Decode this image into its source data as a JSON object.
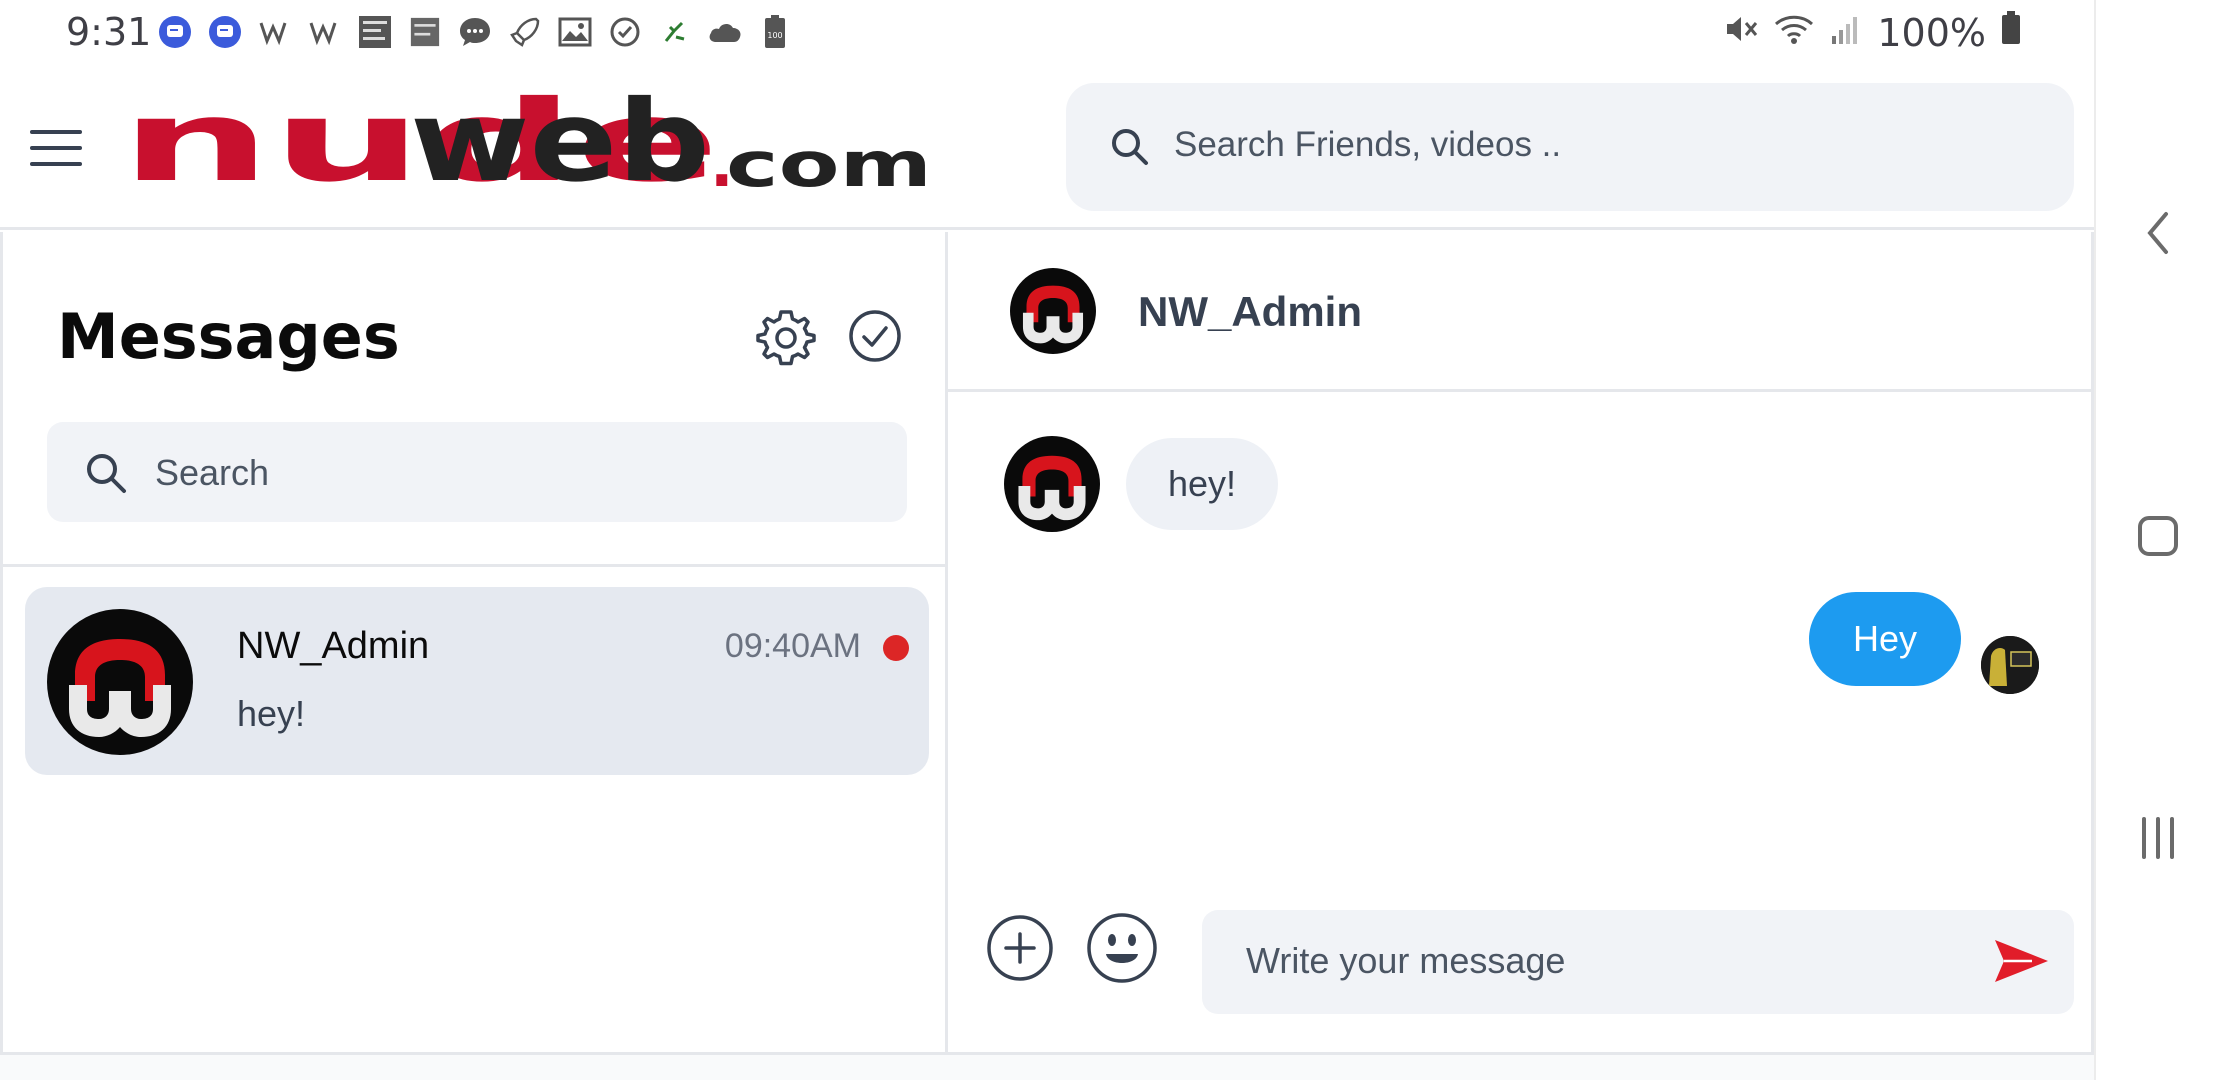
{
  "status_bar": {
    "time": "9:31",
    "battery_percent": "100%",
    "notification_icons": [
      "messages-icon",
      "messages-icon",
      "walmart-icon",
      "walmart-icon",
      "weather-channel-icon",
      "weather-channel-icon",
      "chat-icon",
      "rocket-icon",
      "image-icon",
      "check-icon",
      "dots-icon",
      "cloud-icon",
      "battery-100-icon"
    ],
    "right_icons": [
      "mute-icon",
      "wifi-icon",
      "signal-icon",
      "battery-icon"
    ]
  },
  "header": {
    "logo_text": "nudeweb.com",
    "search_placeholder": "Search Friends, videos .."
  },
  "messages": {
    "title": "Messages",
    "search_placeholder": "Search",
    "conversations": [
      {
        "name": "NW_Admin",
        "time": "09:40AM",
        "preview": "hey!",
        "unread": true
      }
    ]
  },
  "chat": {
    "contact_name": "NW_Admin",
    "messages": [
      {
        "direction": "incoming",
        "text": "hey!"
      },
      {
        "direction": "outgoing",
        "text": "Hey"
      }
    ],
    "input_placeholder": "Write your message"
  },
  "colors": {
    "brand_red": "#c8102e",
    "outgoing_bubble": "#1d9bf0",
    "unread_dot": "#dc2626",
    "send_icon": "#e11d2a"
  }
}
